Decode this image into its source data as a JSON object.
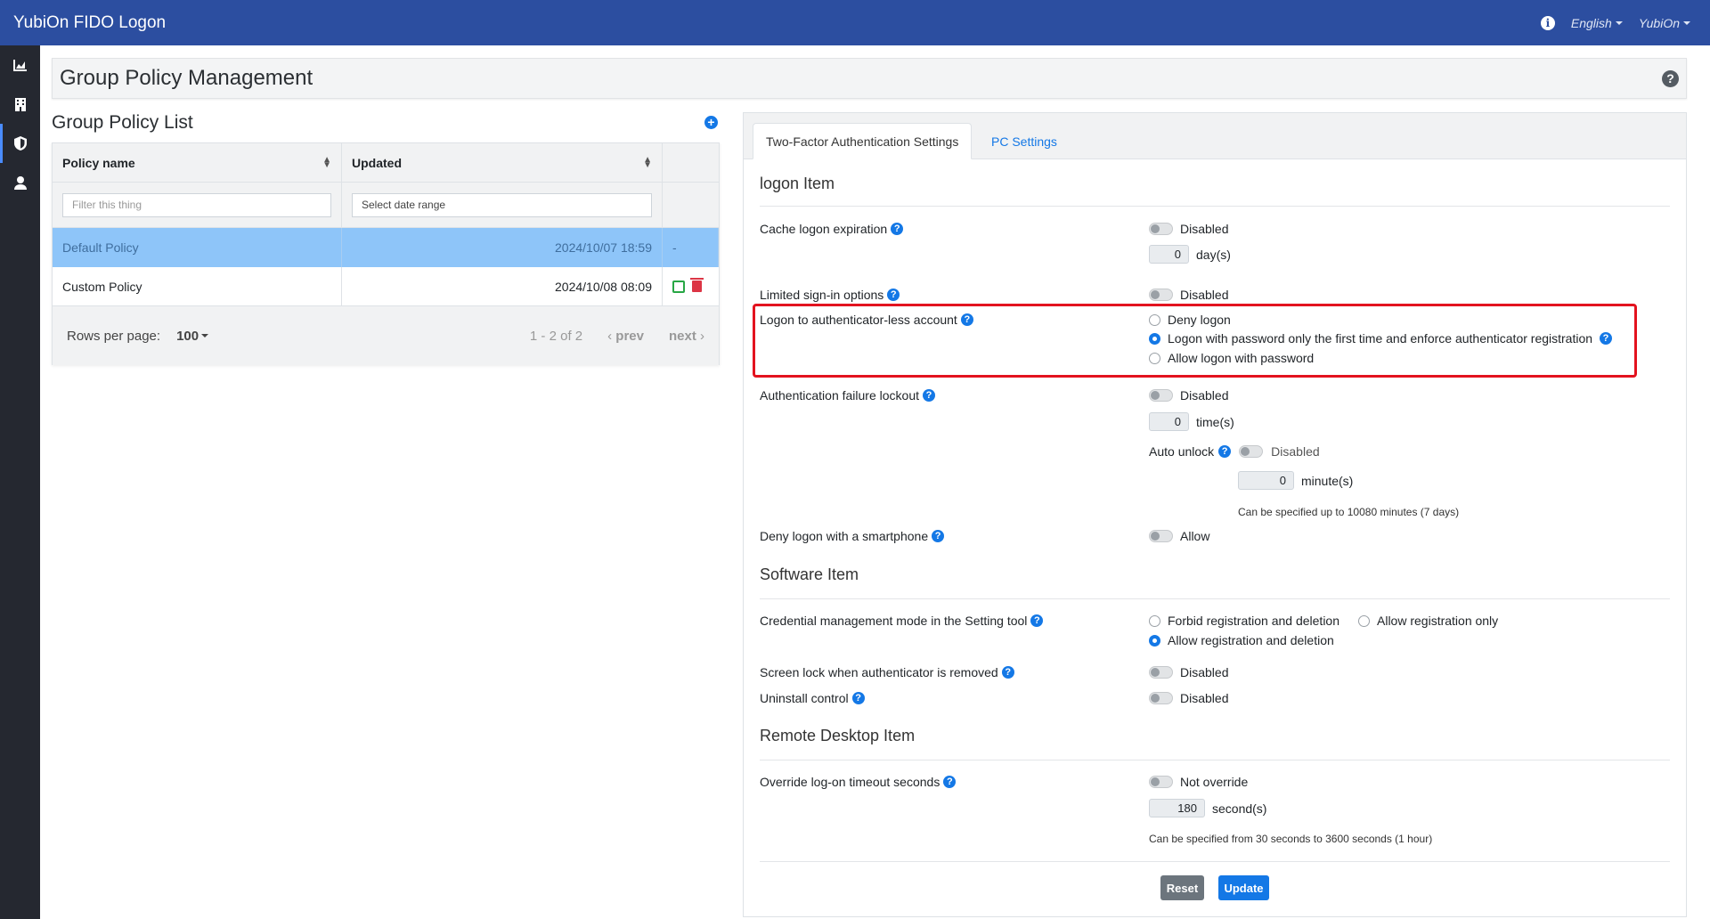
{
  "app": {
    "title": "YubiOn FIDO Logon",
    "language": "English",
    "user": "YubiOn"
  },
  "sidebar": {
    "items": [
      "dashboard-icon",
      "building-icon",
      "shield-icon",
      "user-icon"
    ]
  },
  "page": {
    "title": "Group Policy Management"
  },
  "policy_list": {
    "title": "Group Policy List",
    "columns": [
      "Policy name",
      "Updated"
    ],
    "filter_placeholder": "Filter this thing",
    "date_placeholder": "Select date range",
    "rows": [
      {
        "name": "Default Policy",
        "updated": "2024/10/07 18:59",
        "action": "-"
      },
      {
        "name": "Custom Policy",
        "updated": "2024/10/08 08:09",
        "action": ""
      }
    ],
    "rows_per_page_label": "Rows per page:",
    "rows_per_page": "100",
    "range": "1 - 2 of 2",
    "prev": "prev",
    "next": "next"
  },
  "tabs": {
    "active": "Two-Factor Authentication Settings",
    "other": "PC Settings"
  },
  "logon": {
    "section": "logon Item",
    "cache_expiration": {
      "label": "Cache logon expiration",
      "state": "Disabled",
      "value": "0",
      "unit": "day(s)"
    },
    "limited_signin": {
      "label": "Limited sign-in options",
      "state": "Disabled"
    },
    "authless": {
      "label": "Logon to authenticator-less account",
      "options": [
        "Deny logon",
        "Logon with password only the first time and enforce authenticator registration",
        "Allow logon with password"
      ],
      "selected": 1
    },
    "lockout": {
      "label": "Authentication failure lockout",
      "state": "Disabled",
      "value": "0",
      "unit": "time(s)",
      "auto_unlock_label": "Auto unlock",
      "auto_unlock_state": "Disabled",
      "auto_unlock_value": "0",
      "auto_unlock_unit": "minute(s)",
      "hint": "Can be specified up to 10080 minutes (7 days)"
    },
    "smartphone": {
      "label": "Deny logon with a smartphone",
      "state": "Allow"
    }
  },
  "software": {
    "section": "Software Item",
    "credential": {
      "label": "Credential management mode in the Setting tool",
      "options": [
        "Forbid registration and deletion",
        "Allow registration only",
        "Allow registration and deletion"
      ],
      "selected": 2
    },
    "screen_lock": {
      "label": "Screen lock when authenticator is removed",
      "state": "Disabled"
    },
    "uninstall": {
      "label": "Uninstall control",
      "state": "Disabled"
    }
  },
  "remote": {
    "section": "Remote Desktop Item",
    "timeout": {
      "label": "Override log-on timeout seconds",
      "state": "Not override",
      "value": "180",
      "unit": "second(s)",
      "hint": "Can be specified from 30 seconds to 3600 seconds (1 hour)"
    }
  },
  "buttons": {
    "reset": "Reset",
    "update": "Update"
  },
  "colors": {
    "topbar": "#2c4ea0",
    "accent": "#1478e6",
    "selected_row": "#8ec5f9",
    "highlight": "#e3131f"
  }
}
